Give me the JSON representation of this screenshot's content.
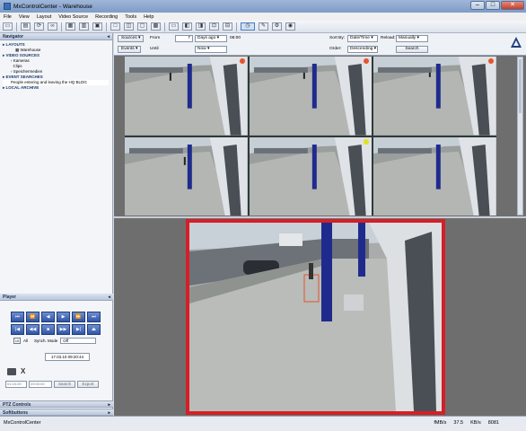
{
  "window": {
    "title": "MxControlCenter - Warehouse",
    "minimize": "–",
    "maximize": "□",
    "close": "✕"
  },
  "menu": [
    "File",
    "View",
    "Layout",
    "Video Source",
    "Recording",
    "Tools",
    "Help"
  ],
  "toolbar": {
    "icons": [
      "new-layout-icon",
      "open-layout-icon",
      "sync-icon",
      "link-icon",
      "layout-grid-icon",
      "sequence-icon",
      "video-source-icon",
      "window-icon",
      "history-icon",
      "wrench-icon",
      "settings-icon"
    ]
  },
  "navigator": {
    "header": "Navigator",
    "sections": [
      {
        "label": "LAYOUTS",
        "children": [
          {
            "label": "Warehouse",
            "level": 1
          }
        ]
      },
      {
        "label": "VIDEO SOURCES",
        "children": [
          {
            "label": "Kameras",
            "level": 1
          },
          {
            "label": "Clips",
            "level": 1
          },
          {
            "label": "Speichermedien",
            "level": 1
          }
        ]
      },
      {
        "label": "EVENT SEARCHES",
        "children": [
          {
            "label": "People entering and leaving the HQ BLDG",
            "level": 2,
            "selected": true
          }
        ]
      },
      {
        "label": "LOCAL ARCHIVE",
        "children": []
      }
    ]
  },
  "player": {
    "header": "Player",
    "controls": [
      "⏮",
      "⏪",
      "◀",
      "▶",
      "⏩",
      "⏭",
      "|◀",
      "◀◀",
      "■",
      "▶▶",
      "▶|",
      "⏏"
    ],
    "mode_box": "10",
    "all_label": "All",
    "synch_label": "Synch. Mode",
    "synch_value": "Off",
    "datetime": "17.03.10 09:20:44",
    "date_field": "01.03.09",
    "time_field": "09:00:00",
    "search_btn": "Search",
    "export_btn": "Export"
  },
  "ptz": {
    "header": "PTZ Controls"
  },
  "softbuttons": {
    "header": "Softbuttons"
  },
  "search": {
    "sources_btn": "Sources",
    "events_btn": "Events",
    "from_label": "From",
    "until_label": "Until",
    "from_value": "7",
    "from_unit": "Days ago",
    "from_time": "06:00",
    "until_value": "Now",
    "sort_label": "Sort By:",
    "sort_value": "Date/Time",
    "order_label": "Order:",
    "order_value": "Descending",
    "reload_label": "Reload:",
    "reload_value": "Manually",
    "search_btn": "Search"
  },
  "accent": {
    "frame": "#d51f26",
    "marker_orange": "#e8542a",
    "marker_yellow": "#e2e21a"
  },
  "cameras": [
    {
      "marker": "orange"
    },
    {
      "marker": "orange"
    },
    {
      "marker": "orange"
    },
    {
      "marker": "yellow"
    },
    {
      "marker": "none"
    },
    {
      "marker": "none"
    }
  ],
  "status": {
    "app": "MxControlCenter",
    "fps_label": "fMB/s",
    "fps_value": "37.5",
    "kb_label": "KB/s",
    "kb_value": "8081"
  }
}
